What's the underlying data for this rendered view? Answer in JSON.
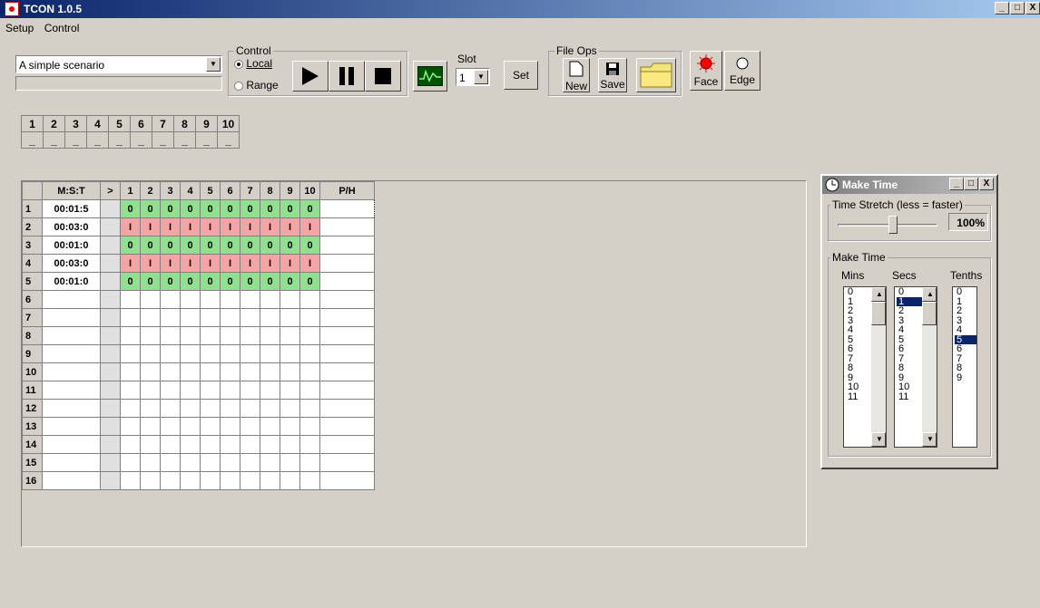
{
  "window": {
    "title": "TCON 1.0.5",
    "min": "_",
    "max": "□",
    "close": "X"
  },
  "menu": [
    "Setup",
    "Control"
  ],
  "scenario": {
    "selected": "A simple scenario"
  },
  "control": {
    "caption": "Control",
    "local": "Local",
    "range": "Range"
  },
  "slot": {
    "caption": "Slot",
    "value": "1",
    "set_label": "Set"
  },
  "fileops": {
    "caption": "File Ops",
    "new_label": "New",
    "save_label": "Save"
  },
  "face_label": "Face",
  "edge_label": "Edge",
  "channels": {
    "headers": [
      "1",
      "2",
      "3",
      "4",
      "5",
      "6",
      "7",
      "8",
      "9",
      "10"
    ],
    "values": [
      "_",
      "_",
      "_",
      "_",
      "_",
      "_",
      "_",
      "_",
      "_",
      "_"
    ]
  },
  "grid": {
    "headers": [
      "",
      "M:S:T",
      ">",
      "1",
      "2",
      "3",
      "4",
      "5",
      "6",
      "7",
      "8",
      "9",
      "10",
      "P/H"
    ],
    "rows": [
      {
        "n": "1",
        "time": "00:01:5",
        "cells": [
          "0",
          "0",
          "0",
          "0",
          "0",
          "0",
          "0",
          "0",
          "0",
          "0"
        ],
        "type": "o"
      },
      {
        "n": "2",
        "time": "00:03:0",
        "cells": [
          "I",
          "I",
          "I",
          "I",
          "I",
          "I",
          "I",
          "I",
          "I",
          "I"
        ],
        "type": "i"
      },
      {
        "n": "3",
        "time": "00:01:0",
        "cells": [
          "0",
          "0",
          "0",
          "0",
          "0",
          "0",
          "0",
          "0",
          "0",
          "0"
        ],
        "type": "o"
      },
      {
        "n": "4",
        "time": "00:03:0",
        "cells": [
          "I",
          "I",
          "I",
          "I",
          "I",
          "I",
          "I",
          "I",
          "I",
          "I"
        ],
        "type": "i"
      },
      {
        "n": "5",
        "time": "00:01:0",
        "cells": [
          "0",
          "0",
          "0",
          "0",
          "0",
          "0",
          "0",
          "0",
          "0",
          "0"
        ],
        "type": "o"
      },
      {
        "n": "6",
        "time": "",
        "cells": [],
        "type": "w"
      },
      {
        "n": "7",
        "time": "",
        "cells": [],
        "type": "w"
      },
      {
        "n": "8",
        "time": "",
        "cells": [],
        "type": "w"
      },
      {
        "n": "9",
        "time": "",
        "cells": [],
        "type": "w"
      },
      {
        "n": "10",
        "time": "",
        "cells": [],
        "type": "w"
      },
      {
        "n": "11",
        "time": "",
        "cells": [],
        "type": "w"
      },
      {
        "n": "12",
        "time": "",
        "cells": [],
        "type": "w"
      },
      {
        "n": "13",
        "time": "",
        "cells": [],
        "type": "w"
      },
      {
        "n": "14",
        "time": "",
        "cells": [],
        "type": "w"
      },
      {
        "n": "15",
        "time": "",
        "cells": [],
        "type": "w"
      },
      {
        "n": "16",
        "time": "",
        "cells": [],
        "type": "w"
      }
    ]
  },
  "maketime": {
    "title": "Make Time",
    "stretch_caption": "Time Stretch (less = faster)",
    "stretch_value": "100%",
    "group_caption": "Make Time",
    "mins_label": "Mins",
    "secs_label": "Secs",
    "tenths_label": "Tenths",
    "mins": [
      "0",
      "1",
      "2",
      "3",
      "4",
      "5",
      "6",
      "7",
      "8",
      "9",
      "10",
      "11"
    ],
    "secs": [
      "0",
      "1",
      "2",
      "3",
      "4",
      "5",
      "6",
      "7",
      "8",
      "9",
      "10",
      "11"
    ],
    "tenths": [
      "0",
      "1",
      "2",
      "3",
      "4",
      "5",
      "6",
      "7",
      "8",
      "9"
    ],
    "secs_selected": "1",
    "tenths_selected": "5"
  }
}
